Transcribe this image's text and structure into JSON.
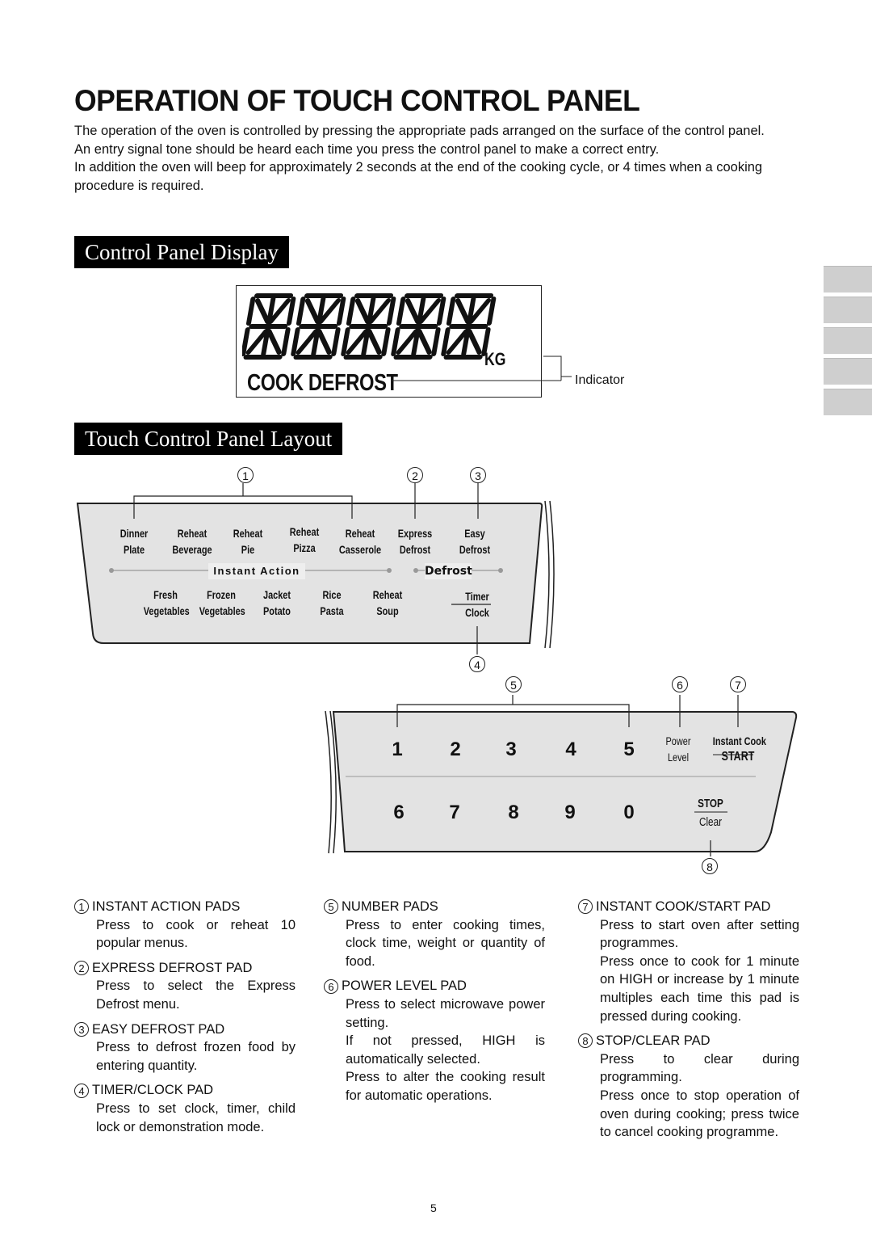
{
  "page": {
    "title": "OPERATION OF TOUCH CONTROL PANEL",
    "intro": [
      "The operation of the oven is controlled by pressing the appropriate pads arranged on the surface of the control panel.",
      "An entry signal tone should be heard each time you press the control panel to make a correct entry.",
      "In addition the oven will beep for approximately 2 seconds at the end of the cooking cycle, or 4 times when a cooking procedure is required."
    ],
    "page_number": "5"
  },
  "display_section": {
    "heading": "Control Panel Display",
    "digit_count": 5,
    "unit_label": "KG",
    "mode_label": "COOK DEFROST",
    "indicator_label": "Indicator"
  },
  "layout_section": {
    "heading": "Touch Control Panel Layout",
    "top_panel": {
      "row1": [
        {
          "line1": "Dinner",
          "line2": "Plate"
        },
        {
          "line1": "Reheat",
          "line2": "Beverage"
        },
        {
          "line1": "Reheat",
          "line2": "Pie"
        },
        {
          "line1": "Reheat",
          "line2": "Pizza"
        },
        {
          "line1": "Reheat",
          "line2": "Casserole"
        },
        {
          "line1": "Express",
          "line2": "Defrost"
        },
        {
          "line1": "Easy",
          "line2": "Defrost"
        }
      ],
      "group_instant_action": "Instant Action",
      "group_defrost": "Defrost",
      "row2": [
        {
          "line1": "Fresh",
          "line2": "Vegetables"
        },
        {
          "line1": "Frozen",
          "line2": "Vegetables"
        },
        {
          "line1": "Jacket",
          "line2": "Potato"
        },
        {
          "line1": "Rice",
          "line2": "Pasta"
        },
        {
          "line1": "Reheat",
          "line2": "Soup"
        }
      ],
      "timer_clock": {
        "line1": "Timer",
        "line2": "Clock"
      }
    },
    "bottom_panel": {
      "numbers_row1": [
        "1",
        "2",
        "3",
        "4",
        "5"
      ],
      "numbers_row2": [
        "6",
        "7",
        "8",
        "9",
        "0"
      ],
      "power_level": {
        "line1": "Power",
        "line2": "Level"
      },
      "start": {
        "line1": "Instant Cook",
        "line2": "START"
      },
      "stop": {
        "line1": "STOP",
        "line2": "Clear"
      }
    },
    "callouts": [
      "1",
      "2",
      "3",
      "4",
      "5",
      "6",
      "7",
      "8"
    ]
  },
  "descriptions": {
    "col1": [
      {
        "num": "1",
        "title": "INSTANT ACTION PADS",
        "body": [
          "Press to cook or reheat 10 popular menus."
        ]
      },
      {
        "num": "2",
        "title": "EXPRESS DEFROST PAD",
        "body": [
          "Press to select the Express Defrost menu."
        ]
      },
      {
        "num": "3",
        "title": "EASY DEFROST PAD",
        "body": [
          "Press to defrost frozen food by entering quantity."
        ]
      },
      {
        "num": "4",
        "title": "TIMER/CLOCK PAD",
        "body": [
          "Press to set clock, timer, child lock or demonstration mode."
        ]
      }
    ],
    "col2": [
      {
        "num": "5",
        "title": "NUMBER PADS",
        "body": [
          "Press to enter cooking times, clock time, weight or quantity of food."
        ]
      },
      {
        "num": "6",
        "title": "POWER LEVEL PAD",
        "body": [
          "Press to select microwave power setting.",
          "If not pressed, HIGH is automatically selected.",
          "Press to alter the cooking result for automatic operations."
        ]
      }
    ],
    "col3": [
      {
        "num": "7",
        "title": "INSTANT COOK/START PAD",
        "body": [
          "Press to start oven after setting programmes.",
          "Press once to cook for 1 minute on HIGH or increase by 1 minute multiples each time this pad is pressed during cooking."
        ]
      },
      {
        "num": "8",
        "title": "STOP/CLEAR PAD",
        "body": [
          "Press to clear during programming.",
          "Press once to stop operation of oven during cooking; press twice to cancel cooking programme."
        ]
      }
    ]
  }
}
